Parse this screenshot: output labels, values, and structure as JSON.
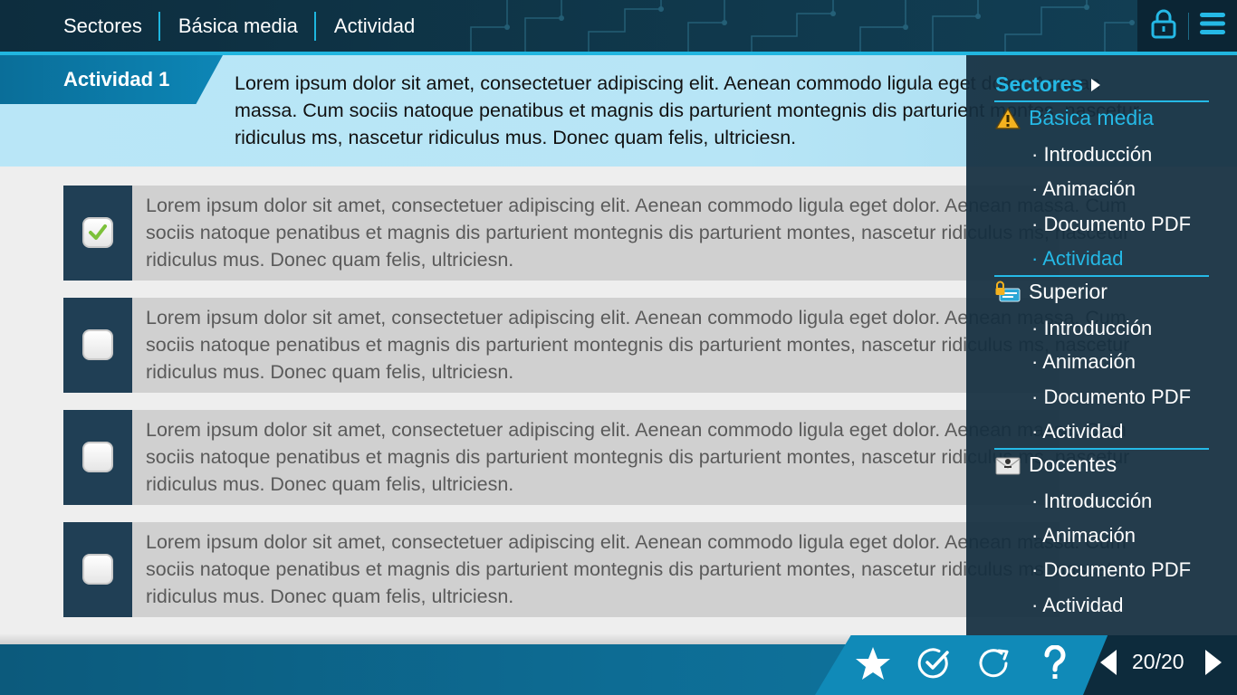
{
  "topbar": {
    "breadcrumbs": [
      "Sectores",
      "Básica media",
      "Actividad"
    ],
    "icons": {
      "lock": "lock-icon",
      "menu": "menu-icon"
    }
  },
  "activity": {
    "tag": "Actividad 1",
    "statement": "Lorem ipsum dolor sit amet, consectetuer adipiscing elit. Aenean commodo ligula eget dolor. Aenean massa. Cum sociis natoque penatibus et magnis dis parturient montegnis dis parturient montes, nascetur ridiculus ms, nascetur ridiculus mus. Donec quam felis, ultriciesn."
  },
  "options": [
    {
      "checked": true,
      "text": "Lorem ipsum dolor sit amet, consectetuer adipiscing elit. Aenean commodo ligula eget dolor. Aenean massa. Cum sociis natoque penatibus et magnis dis parturient montegnis dis parturient montes, nascetur ridiculus ms, nascetur ridiculus mus. Donec quam felis, ultriciesn."
    },
    {
      "checked": false,
      "text": "Lorem ipsum dolor sit amet, consectetuer adipiscing elit. Aenean commodo ligula eget dolor. Aenean massa. Cum sociis natoque penatibus et magnis dis parturient montegnis dis parturient montes, nascetur ridiculus ms, nascetur ridiculus mus. Donec quam felis, ultriciesn."
    },
    {
      "checked": false,
      "text": "Lorem ipsum dolor sit amet, consectetuer adipiscing elit. Aenean commodo ligula eget dolor. Aenean massa. Cum sociis natoque penatibus et magnis dis parturient montegnis dis parturient montes, nascetur ridiculus ms, nascetur ridiculus mus. Donec quam felis, ultriciesn."
    },
    {
      "checked": false,
      "text": "Lorem ipsum dolor sit amet, consectetuer adipiscing elit. Aenean commodo ligula eget dolor. Aenean massa. Cum sociis natoque penatibus et magnis dis parturient montegnis dis parturient montes, nascetur ridiculus ms, nascetur ridiculus mus. Donec quam felis, ultriciesn."
    }
  ],
  "menu": {
    "title": "Sectores",
    "sections": [
      {
        "label": "Básica media",
        "icon": "warning-icon",
        "active": true,
        "items": [
          "· Introducción",
          "· Animación",
          "· Documento PDF",
          "· Actividad"
        ],
        "active_item": 3
      },
      {
        "label": "Superior",
        "icon": "locked-card-icon",
        "active": false,
        "items": [
          "· Introducción",
          "· Animación",
          "· Documento PDF",
          "· Actividad"
        ]
      },
      {
        "label": "Docentes",
        "icon": "envelope-icon",
        "active": false,
        "items": [
          "· Introducción",
          "· Animación",
          "· Documento PDF",
          "· Actividad"
        ]
      }
    ]
  },
  "toolbar": {
    "icons": [
      "star-icon",
      "check-circle-icon",
      "refresh-icon",
      "help-icon"
    ]
  },
  "pager": {
    "count": "20/20"
  },
  "colors": {
    "accent": "#25b9e6",
    "dark": "#203f55",
    "bar": "#0d6c94"
  }
}
